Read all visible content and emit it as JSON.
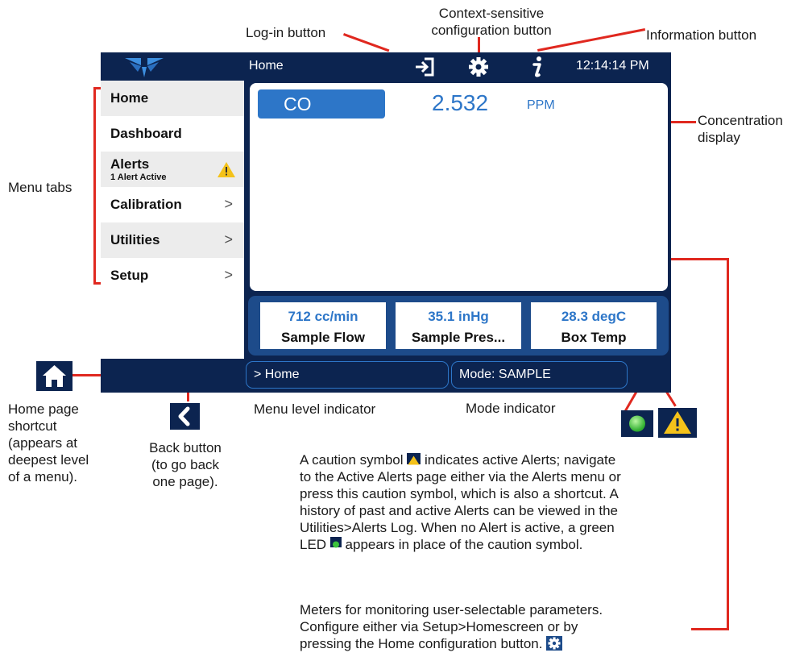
{
  "annotations": {
    "login_button": "Log-in button",
    "config_button_line1": "Context-sensitive",
    "config_button_line2": "configuration button",
    "info_button": "Information button",
    "concentration_line1": "Concentration",
    "concentration_line2": "display",
    "menu_tabs": "Menu tabs",
    "home_shortcut": [
      "Home page",
      "shortcut",
      "(appears at",
      "deepest level",
      "of a menu)."
    ],
    "back_button": [
      "Back button",
      "(to go back",
      "one page)."
    ],
    "menu_level": "Menu level indicator",
    "mode_indicator": "Mode indicator",
    "alerts_note": [
      "A caution symbol",
      "indicates active Alerts; navigate",
      "to the Active Alerts page either via the Alerts menu or",
      "press this caution symbol, which is also a shortcut. A",
      "history of past and active Alerts can be viewed in the",
      "Utilities>Alerts Log. When no Alert is active, a green",
      "LED",
      "appears in place of the caution symbol."
    ],
    "meters_note": [
      "Meters for monitoring user-selectable parameters.",
      "Configure either via Setup>Homescreen or by",
      "pressing the Home configuration button."
    ]
  },
  "screen": {
    "title": "Home",
    "clock": "12:14:14 PM",
    "icons": {
      "login": "login-arrow-icon",
      "config": "gear-icon",
      "info": "info-icon"
    },
    "menu": [
      {
        "label": "Home",
        "chevron": ""
      },
      {
        "label": "Dashboard",
        "chevron": ""
      },
      {
        "label": "Alerts",
        "sub": "1 Alert Active",
        "chevron": ""
      },
      {
        "label": "Calibration",
        "chevron": ">"
      },
      {
        "label": "Utilities",
        "chevron": ">"
      },
      {
        "label": "Setup",
        "chevron": ">"
      }
    ],
    "concentration": {
      "gas": "CO",
      "value": "2.532",
      "unit": "PPM"
    },
    "meters": [
      {
        "value": "712 cc/min",
        "name": "Sample Flow"
      },
      {
        "value": "35.1 inHg",
        "name": "Sample Pres..."
      },
      {
        "value": "28.3 degC",
        "name": "Box Temp"
      }
    ],
    "breadcrumb": "> Home",
    "mode": "Mode: SAMPLE"
  },
  "colors": {
    "bar": "#0c2450",
    "accent": "#2d76c8",
    "leader": "#e0281f",
    "warning": "#f4c21a",
    "led": "#3cc23c"
  }
}
